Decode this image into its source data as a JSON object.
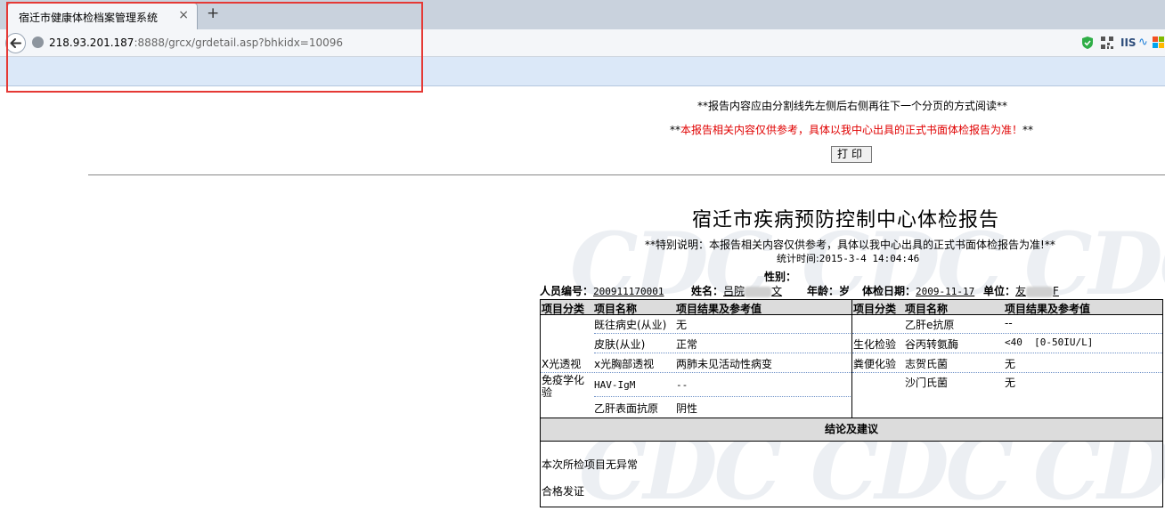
{
  "browser": {
    "tab_title": "宿迁市健康体检档案管理系统",
    "tab_close": "×",
    "new_tab": "+",
    "url_host": "218.93.201.187",
    "url_rest": ":8888/grcx/grdetail.asp?bhkidx=10096",
    "toolbar_iis": "IIS",
    "colors": {
      "highlight": "#e53935",
      "bookmarks_bar": "#dbe8f8"
    }
  },
  "page": {
    "notice_line1": "**报告内容应由分割线先左侧后右侧再往下一个分页的方式阅读**",
    "notice_line2_prefix": "**",
    "notice_line2_red": "本报告相关内容仅供参考，具体以我中心出具的正式书面体检报告为准！",
    "notice_line2_suffix": "**",
    "print_button": "打印",
    "watermark_text": "CDC"
  },
  "report": {
    "title": "宿迁市疾病预防控制中心体检报告",
    "special_note": "**特别说明：本报告相关内容仅供参考，具体以我中心出具的正式书面体检报告为准!**",
    "stat_label": "统计时间:",
    "stat_time": "2015-3-4 14:04:46",
    "gender_label": "性别：",
    "person_id_label": "人员编号：",
    "person_id": "200911170001",
    "name_label": "姓名：",
    "name_visible_start": "吕院",
    "name_visible_end": "文",
    "age_label": "年龄：岁",
    "exam_date_label": "体检日期：",
    "exam_date": "2009-11-17",
    "unit_label": "单位：",
    "unit_visible_start": "友",
    "unit_visible_end": "F",
    "headers": [
      "项目分类",
      "项目名称",
      "项目结果及参考值"
    ],
    "left_rows": [
      {
        "category": "",
        "item": "既往病史(从业)",
        "result": "无"
      },
      {
        "category": "",
        "item": "皮肤(从业)",
        "result": "正常"
      },
      {
        "category": "X光透视",
        "item": "x光胸部透视",
        "result": "两肺未见活动性病变"
      },
      {
        "category": "免疫学化验",
        "item": "HAV-IgM",
        "result": "--"
      },
      {
        "category": "",
        "item": "乙肝表面抗原",
        "result": "阴性"
      }
    ],
    "right_rows": [
      {
        "category": "",
        "item": "乙肝e抗原",
        "result": "--"
      },
      {
        "category": "生化检验",
        "item": "谷丙转氨酶",
        "result": "<40  [0-50IU/L]"
      },
      {
        "category": "粪便化验",
        "item": "志贺氏菌",
        "result": "无"
      },
      {
        "category": "",
        "item": "沙门氏菌",
        "result": "无"
      }
    ],
    "conclusion_header": "结论及建议",
    "conclusion_line1": "本次所检项目无异常",
    "conclusion_line2": "合格发证"
  }
}
